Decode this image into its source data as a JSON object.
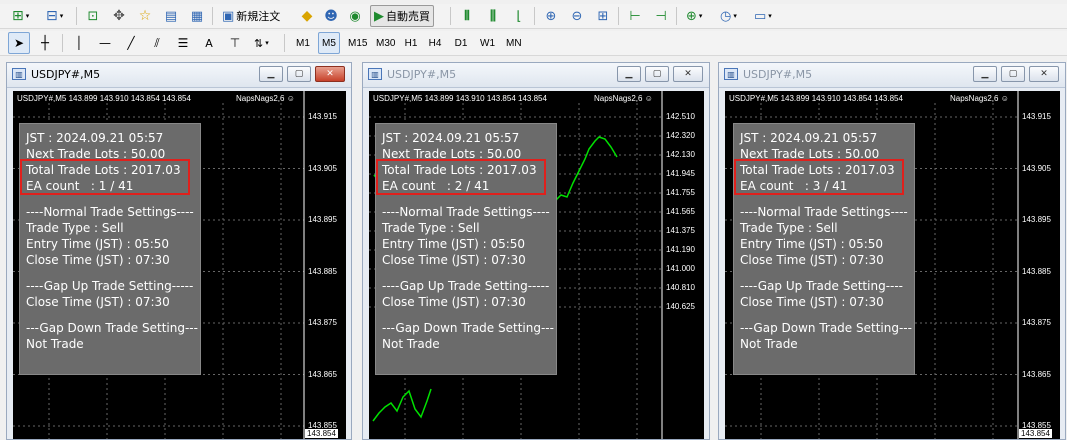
{
  "toolbar1": {
    "new_order_label": "新規注文",
    "auto_trading_label": "自動売買"
  },
  "toolbar2": {
    "timeframes": [
      "M1",
      "M5",
      "M15",
      "M30",
      "H1",
      "H4",
      "D1",
      "W1",
      "MN"
    ],
    "active_timeframe": "M5",
    "text_tool_label": "A"
  },
  "windows": [
    {
      "title": "USDJPY#,M5",
      "active": true,
      "ohlc": "USDJPY#,M5  143.899 143.910 143.854 143.854",
      "ea_name": "NapsNags2,6",
      "axis": [
        "143.915",
        "143.905",
        "143.895",
        "143.885",
        "143.875",
        "143.865",
        "143.855"
      ],
      "current_price": "143.854",
      "info": {
        "jst": "JST : 2024.09.21 05:57",
        "next_lots": "Next Trade Lots : 50.00",
        "total_lots": "Total Trade Lots : 2017.03",
        "ea_count": "EA count   : 1 / 41",
        "normal_header": "----Normal Trade Settings----",
        "trade_type": "Trade Type : Sell",
        "entry_time": "Entry Time (JST) : 05:50",
        "close_time": "Close Time (JST) : 07:30",
        "gapup_header": "----Gap Up Trade Setting-----",
        "gapup_close": "Close Time (JST) : 07:30",
        "gapdown_header": "---Gap Down Trade Setting---",
        "gapdown_value": "Not Trade"
      }
    },
    {
      "title": "USDJPY#,M5",
      "active": false,
      "ohlc": "USDJPY#,M5  143.899 143.910 143.854 143.854",
      "ea_name": "NapsNags2,6",
      "axis": [
        "142.510",
        "142.320",
        "142.130",
        "141.945",
        "141.755",
        "141.565",
        "141.375",
        "141.190",
        "141.000",
        "140.810",
        "140.625"
      ],
      "current_price": "",
      "info": {
        "jst": "JST : 2024.09.21 05:57",
        "next_lots": "Next Trade Lots : 50.00",
        "total_lots": "Total Trade Lots : 2017.03",
        "ea_count": "EA count   : 2 / 41",
        "normal_header": "----Normal Trade Settings----",
        "trade_type": "Trade Type : Sell",
        "entry_time": "Entry Time (JST) : 05:50",
        "close_time": "Close Time (JST) : 07:30",
        "gapup_header": "----Gap Up Trade Setting-----",
        "gapup_close": "Close Time (JST) : 07:30",
        "gapdown_header": "---Gap Down Trade Setting---",
        "gapdown_value": "Not Trade"
      }
    },
    {
      "title": "USDJPY#,M5",
      "active": false,
      "ohlc": "USDJPY#,M5  143.899 143.910 143.854 143.854",
      "ea_name": "NapsNags2,6",
      "axis": [
        "143.915",
        "143.905",
        "143.895",
        "143.885",
        "143.875",
        "143.865",
        "143.855"
      ],
      "current_price": "143.854",
      "info": {
        "jst": "JST : 2024.09.21 05:57",
        "next_lots": "Next Trade Lots : 50.00",
        "total_lots": "Total Trade Lots : 2017.03",
        "ea_count": "EA count   : 3 / 41",
        "normal_header": "----Normal Trade Settings----",
        "trade_type": "Trade Type : Sell",
        "entry_time": "Entry Time (JST) : 05:50",
        "close_time": "Close Time (JST) : 07:30",
        "gapup_header": "----Gap Up Trade Setting----",
        "gapup_close": "Close Time (JST) : 07:30",
        "gapdown_header": "---Gap Down Trade Setting---",
        "gapdown_value": "Not Trade"
      }
    }
  ],
  "colors": {
    "chart_bg": "#000000",
    "candle": "#00e000",
    "panel_bg": "#6b6b6b",
    "highlight": "#e0201c"
  }
}
